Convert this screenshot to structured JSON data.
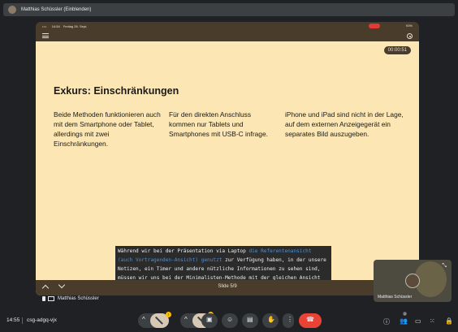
{
  "topbar": {
    "title": "Matthias Schüssler (Einblenden)"
  },
  "ipad": {
    "time": "14:54",
    "date": "Freitag 26. Sept.",
    "battery": "93%",
    "timer": "00:00:51"
  },
  "slide": {
    "title": "Exkurs: Einschränkungen",
    "col1": "Beide Methoden funktionieren auch mit dem Smartphone oder Tablet, allerdings mit zwei Einschränkungen.",
    "col2": "Für den direkten Anschluss kommen nur Tablets und Smartphones mit USB-C infrage.",
    "col3": "iPhone und iPad sind nicht in der Lage, auf dem externen Anzeigegerät ein separates Bild auszugeben.",
    "caption_pre": "Während wir bei der Präsentation via Laptop ",
    "caption_hl": "die Referentenansicht (auch Vortragenden-Ansicht) genutzt",
    "caption_post": " zur Verfügung haben, in der unsere Notizen, ein Timer und andere nützliche Informationen zu sehen sind, müssen wir uns bei der Minimalisten-Methode mit der gleichen Ansicht begnügen, die auch das Publikum sieht.",
    "slide_number": "Slide 5/9"
  },
  "presenter": {
    "name": "Matthias Schüssler"
  },
  "self_tile": {
    "name": "Matthias Schüssler"
  },
  "controls": {
    "clock": "14:55",
    "meeting_code": "csg-adgq-vjx",
    "mic_badge": "!",
    "cam_badge": "!",
    "participants_count": "2"
  },
  "colors": {
    "slide_bg": "#fbe6b4",
    "chrome": "#4a3c2b",
    "end_call": "#ea4335"
  }
}
